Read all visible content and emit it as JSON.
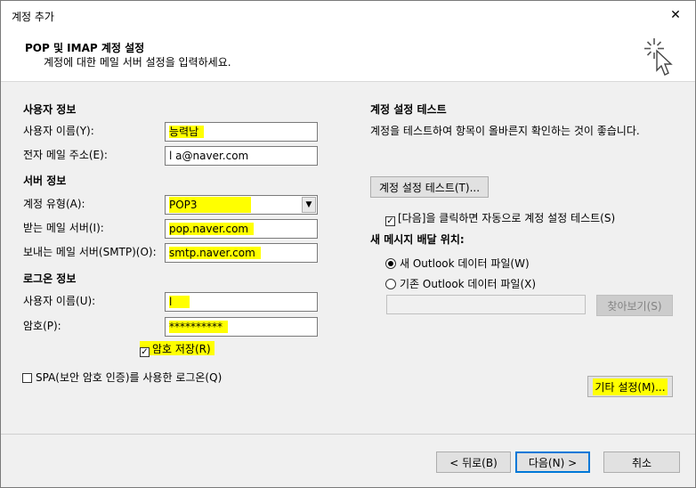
{
  "window": {
    "title": "계정 추가",
    "close_glyph": "✕"
  },
  "header": {
    "title": "POP 및 IMAP 계정 설정",
    "subtitle": "계정에 대한 메일 서버 설정을 입력하세요.",
    "icon": "cursor-sparkle-icon"
  },
  "user_info": {
    "section": "사용자 정보",
    "name_label": "사용자 이름(Y):",
    "name_value": "능력남",
    "email_label": "전자 메일 주소(E):",
    "email_value": "l     a@naver.com"
  },
  "server_info": {
    "section": "서버 정보",
    "type_label": "계정 유형(A):",
    "type_value": "POP3",
    "incoming_label": "받는 메일 서버(I):",
    "incoming_value": "pop.naver.com",
    "outgoing_label": "보내는 메일 서버(SMTP)(O):",
    "outgoing_value": "smtp.naver.com"
  },
  "logon_info": {
    "section": "로그온 정보",
    "user_label": "사용자 이름(U):",
    "user_value": "l      ",
    "password_label": "암호(P):",
    "password_value": "**********",
    "save_password_label": "암호 저장(R)",
    "save_password_checked": true,
    "spa_label": "SPA(보안 암호 인증)를 사용한 로그온(Q)",
    "spa_checked": false
  },
  "test_settings": {
    "section": "계정 설정 테스트",
    "description": "계정을 테스트하여 항목이 올바른지 확인하는 것이 좋습니다.",
    "test_button": "계정 설정 테스트(T)...",
    "auto_test_label": "[다음]을 클릭하면 자동으로 계정 설정 테스트(S)",
    "auto_test_checked": true
  },
  "delivery": {
    "section": "새 메시지 배달 위치:",
    "new_file_label": "새 Outlook 데이터 파일(W)",
    "new_file_selected": true,
    "existing_file_label": "기존 Outlook 데이터 파일(X)",
    "existing_file_value": "",
    "browse_button": "찾아보기(S)"
  },
  "more_settings_button": "기타 설정(M)...",
  "footer": {
    "back_button": "< 뒤로(B)",
    "next_button": "다음(N) >",
    "cancel_button": "취소"
  },
  "colors": {
    "highlight": "#ffff00",
    "accent": "#0078d7"
  }
}
